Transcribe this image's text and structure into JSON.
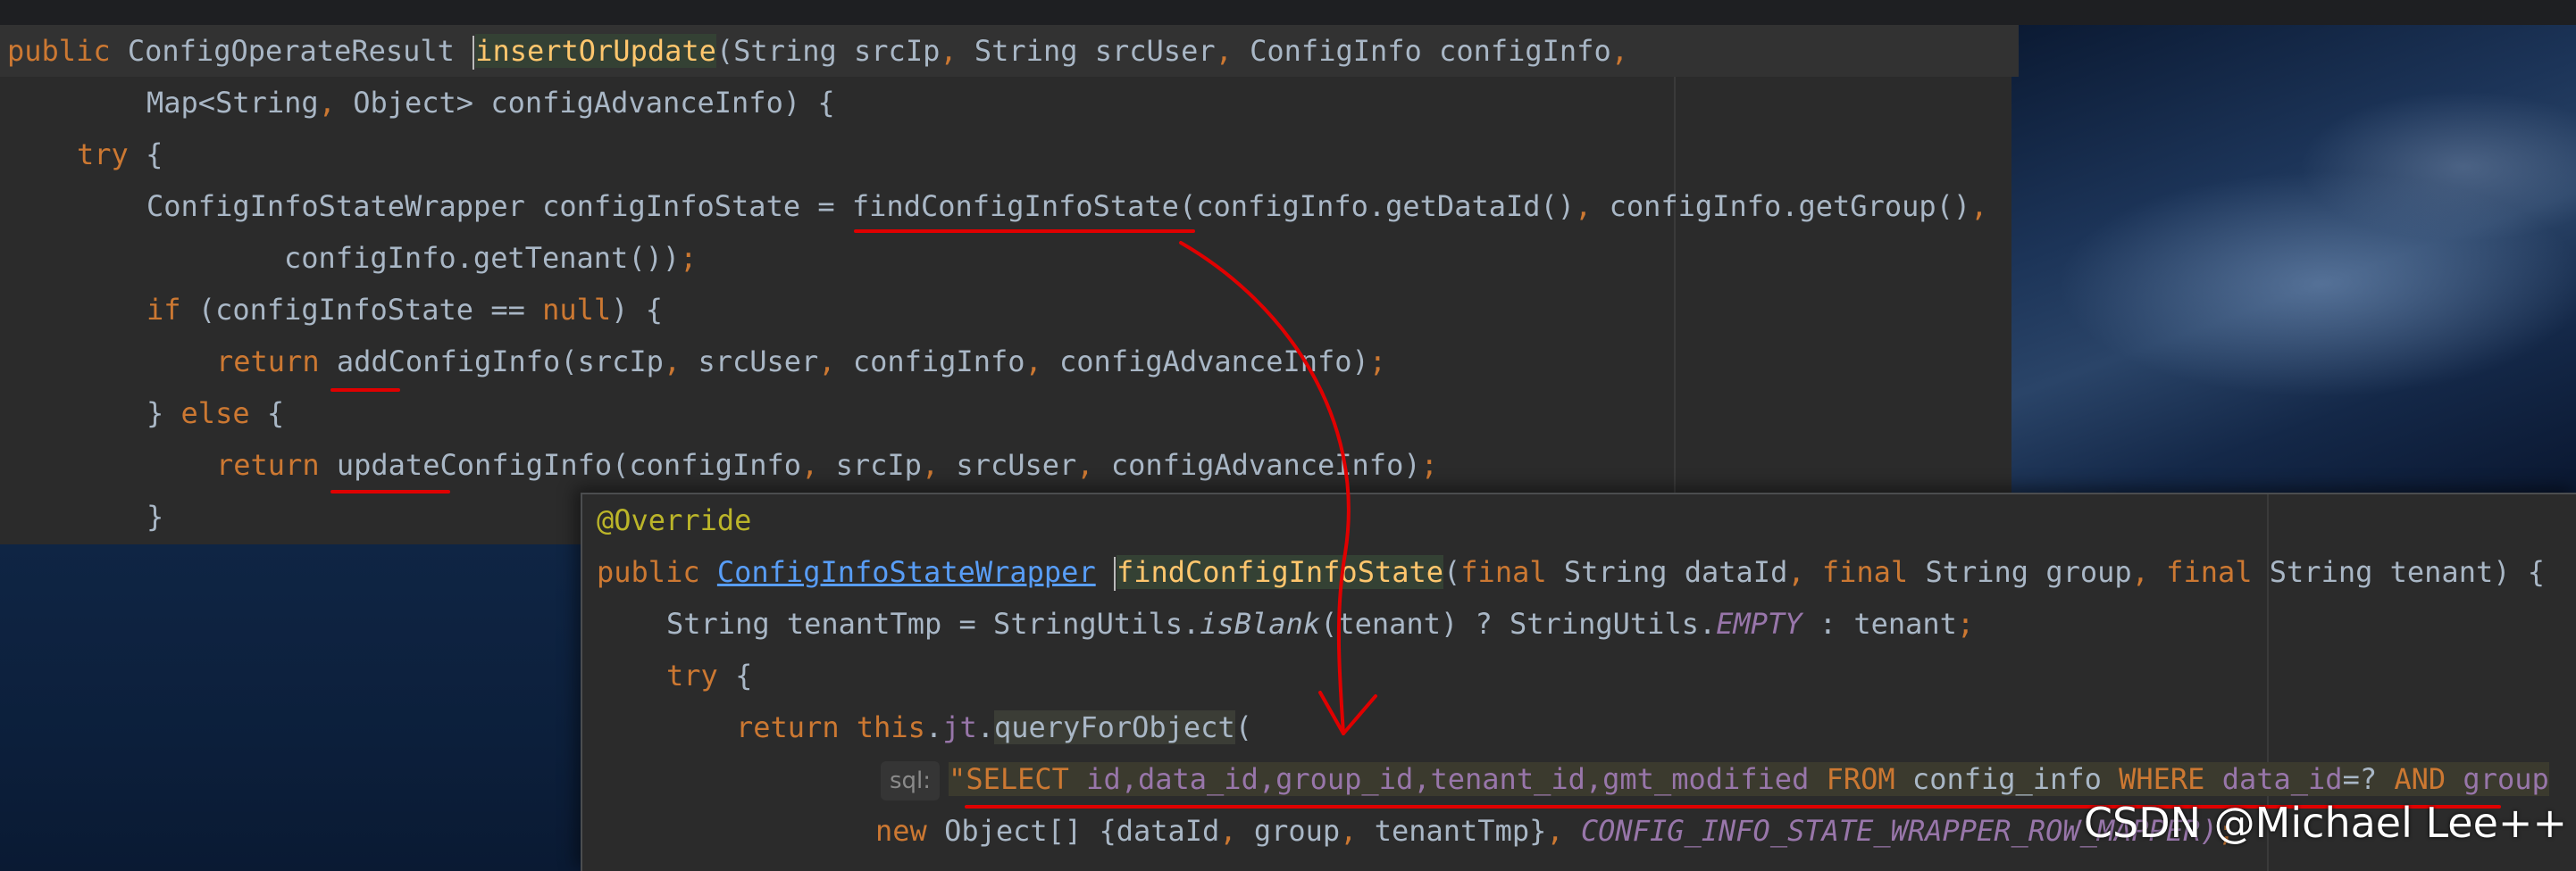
{
  "editor": {
    "lines": {
      "l1": {
        "kw_public": "public",
        "type": "ConfigOperateResult",
        "method": "insertOrUpdate",
        "params": "(String srcIp",
        "c1": ",",
        "p2": " String srcUser",
        "c2": ",",
        "p3": " ConfigInfo configInfo",
        "c3": ","
      },
      "l2": {
        "text": "Map<String",
        "c1": ",",
        "rest": " Object> configAdvanceInfo) {"
      },
      "l3": {
        "kw": "try",
        "rest": " {"
      },
      "l4": {
        "pre": "ConfigInfoStateWrapper configInfoState = ",
        "method": "findConfigInfoState",
        "a1": "(configInfo.getDataId()",
        "c1": ",",
        "a2": " configInfo.getGroup()",
        "c2": ","
      },
      "l5": {
        "text": "configInfo.getTenant())",
        "semi": ";"
      },
      "l6": {
        "kw": "if",
        "mid": " (configInfoState == ",
        "kw_null": "null",
        "rest": ") {"
      },
      "l7": {
        "kw": "return",
        "method": " addConfigInfo",
        "a1": "(srcIp",
        "c1": ",",
        "a2": " srcUser",
        "c2": ",",
        "a3": " configInfo",
        "c3": ",",
        "a4": " configAdvanceInfo)",
        "semi": ";"
      },
      "l8": {
        "pre": "} ",
        "kw": "else",
        "rest": " {"
      },
      "l9": {
        "kw": "return",
        "method": " updateConfigInfo",
        "a1": "(configInfo",
        "c1": ",",
        "a2": " srcIp",
        "c2": ",",
        "a3": " srcUser",
        "c3": ",",
        "a4": " configAdvanceInfo)",
        "semi": ";"
      },
      "l10": {
        "text": "}"
      }
    }
  },
  "popup": {
    "lines": {
      "p1": {
        "annotation": "@Override"
      },
      "p2": {
        "kw_public": "public",
        "type_link": "ConfigInfoStateWrapper",
        "method": "findConfigInfoState",
        "o": "(",
        "kw_final1": "final",
        "a1": " String dataId",
        "c1": ",",
        "kw_final2": "final",
        "a2": " String group",
        "c2": ",",
        "kw_final3": "final",
        "a3": " String tenant) {"
      },
      "p3": {
        "pre": "String tenantTmp = StringUtils.",
        "static_method": "isBlank",
        "mid": "(tenant) ? StringUtils.",
        "const": "EMPTY",
        "rest": " : tenant",
        "semi": ";"
      },
      "p4": {
        "kw": "try",
        "rest": " {"
      },
      "p5": {
        "kw": "return",
        "kw_this": " this",
        "dot": ".",
        "field": "jt",
        "dot2": ".",
        "method": "queryForObject",
        "rest": "("
      },
      "p6": {
        "chip": "sql:",
        "q": "\"",
        "select": "SELECT",
        "cols": " id,data_id,group_id,tenant_id,gmt_modified",
        "from": " FROM",
        "table": " config_info",
        "where": " WHERE",
        "col2": " data_id",
        "eq": "=?",
        "and": " AND",
        "col3": " group"
      },
      "p7": {
        "kw_new": "new",
        "rest": " Object[] {dataId",
        "c1": ",",
        "a2": " group",
        "c2": ",",
        "a3": " tenantTmp}",
        "c3": ",",
        "const": " CONFIG_INFO_STATE_WRAPPER_ROW_MAPPER)",
        "semi": ";"
      }
    }
  },
  "watermark": "CSDN @Michael Lee++",
  "colors": {
    "annotation_red": "#e00000",
    "keyword": "#cc7832",
    "method": "#ffc66d",
    "plain": "#a9b7c6",
    "static": "#9876aa",
    "link": "#589df6",
    "annotation": "#bbb529"
  }
}
